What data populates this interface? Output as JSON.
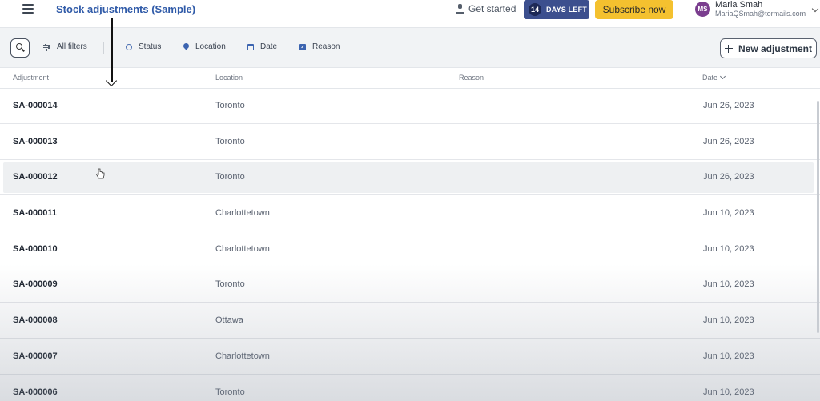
{
  "header": {
    "title": "Stock adjustments (Sample)",
    "get_started": "Get started",
    "trial_days": "14",
    "trial_label": "DAYS LEFT",
    "subscribe_label": "Subscribe now",
    "user": {
      "initials": "MS",
      "name": "Maria Smah",
      "email": "MariaQSmah@tormails.com"
    }
  },
  "toolbar": {
    "filters": [
      {
        "label": "All filters",
        "icon": "sliders-icon"
      },
      {
        "label": "Status",
        "icon": "circle-icon"
      },
      {
        "label": "Location",
        "icon": "location-pin-icon"
      },
      {
        "label": "Date",
        "icon": "calendar-icon"
      },
      {
        "label": "Reason",
        "icon": "edit-icon"
      }
    ],
    "new_button_label": "New adjustment"
  },
  "table": {
    "columns": [
      "Adjustment",
      "Location",
      "Reason",
      "Date"
    ],
    "rows": [
      {
        "id": "SA-000014",
        "location": "Toronto",
        "reason": "",
        "date": "Jun 26, 2023"
      },
      {
        "id": "SA-000013",
        "location": "Toronto",
        "reason": "",
        "date": "Jun 26, 2023"
      },
      {
        "id": "SA-000012",
        "location": "Toronto",
        "reason": "",
        "date": "Jun 26, 2023"
      },
      {
        "id": "SA-000011",
        "location": "Charlottetown",
        "reason": "",
        "date": "Jun 10, 2023"
      },
      {
        "id": "SA-000010",
        "location": "Charlottetown",
        "reason": "",
        "date": "Jun 10, 2023"
      },
      {
        "id": "SA-000009",
        "location": "Toronto",
        "reason": "",
        "date": "Jun 10, 2023"
      },
      {
        "id": "SA-000008",
        "location": "Ottawa",
        "reason": "",
        "date": "Jun 10, 2023"
      },
      {
        "id": "SA-000007",
        "location": "Charlottetown",
        "reason": "",
        "date": "Jun 10, 2023"
      },
      {
        "id": "SA-000006",
        "location": "Toronto",
        "reason": "",
        "date": "Jun 10, 2023"
      }
    ]
  },
  "colors": {
    "title_blue": "#2f5aa8",
    "trial_badge": "#3c4f8e",
    "subscribe": "#f4c12f",
    "avatar": "#7a3d8e"
  }
}
